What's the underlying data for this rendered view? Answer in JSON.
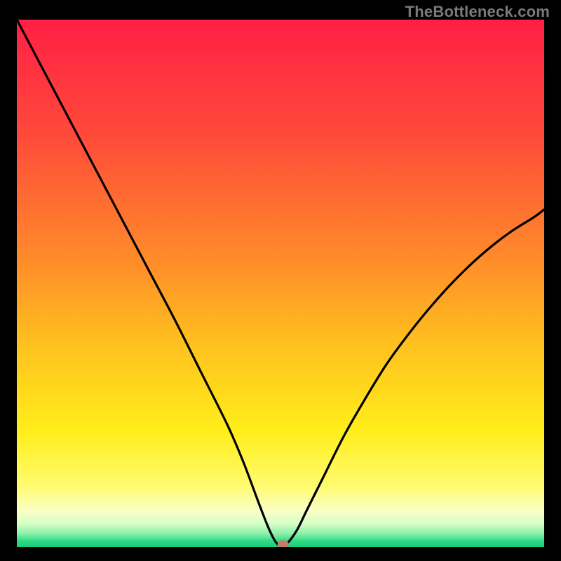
{
  "watermark": "TheBottleneck.com",
  "chart_data": {
    "type": "line",
    "title": "",
    "xlabel": "",
    "ylabel": "",
    "xlim": [
      0,
      100
    ],
    "ylim": [
      0,
      100
    ],
    "grid": false,
    "legend": false,
    "annotations": [],
    "marker": {
      "x": 50.5,
      "y": 0.5,
      "color": "#c77a6a"
    },
    "series": [
      {
        "name": "curve",
        "x": [
          0,
          5,
          10,
          15,
          20,
          25,
          30,
          35,
          40,
          43,
          46,
          48,
          49.5,
          51,
          53,
          55,
          58,
          62,
          66,
          70,
          74,
          78,
          82,
          86,
          90,
          94,
          98,
          100
        ],
        "values": [
          100,
          90.5,
          81,
          71.5,
          62,
          52.5,
          43,
          33,
          23,
          16,
          8,
          3,
          0.5,
          0.5,
          3,
          7,
          13,
          21,
          28,
          34.5,
          40,
          45,
          49.5,
          53.5,
          57,
          60,
          62.5,
          64
        ]
      }
    ],
    "background_gradient": {
      "stops": [
        {
          "offset": 0.0,
          "color": "#ff1f45"
        },
        {
          "offset": 0.22,
          "color": "#ff4a3a"
        },
        {
          "offset": 0.45,
          "color": "#ff8a2a"
        },
        {
          "offset": 0.62,
          "color": "#ffc21e"
        },
        {
          "offset": 0.78,
          "color": "#ffee1a"
        },
        {
          "offset": 0.885,
          "color": "#fffb70"
        },
        {
          "offset": 0.93,
          "color": "#fbffc4"
        },
        {
          "offset": 0.955,
          "color": "#d9ffc8"
        },
        {
          "offset": 0.975,
          "color": "#8af0a8"
        },
        {
          "offset": 0.99,
          "color": "#27d884"
        },
        {
          "offset": 1.0,
          "color": "#18cf7c"
        }
      ]
    }
  }
}
